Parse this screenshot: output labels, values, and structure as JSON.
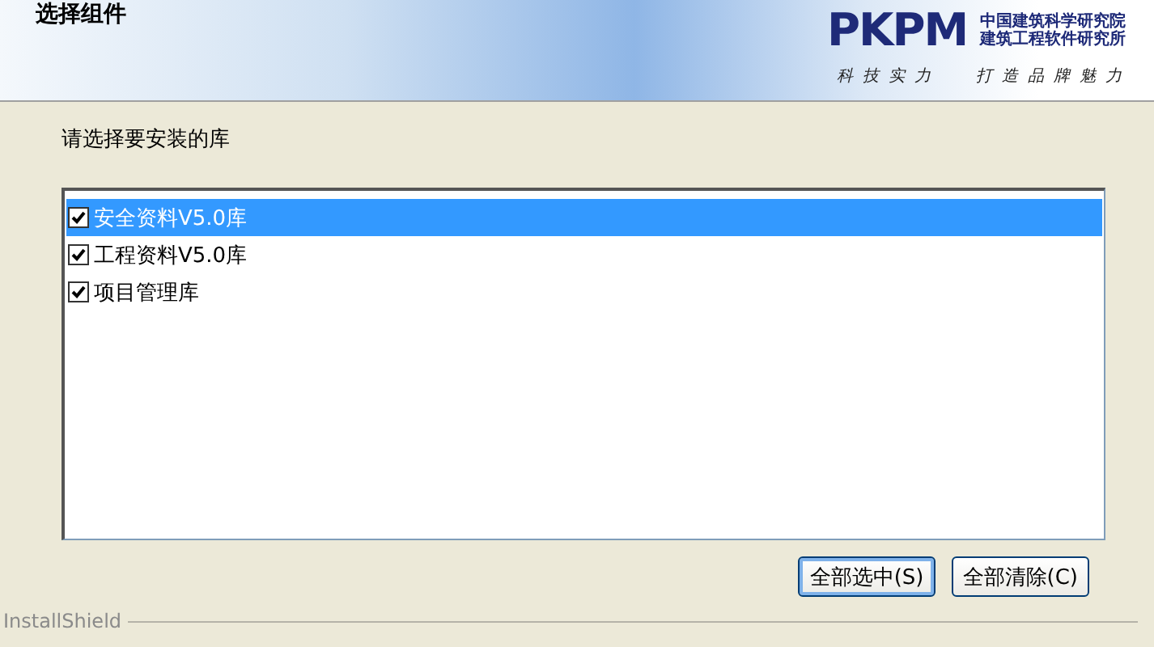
{
  "header": {
    "title": "选择组件",
    "logo": {
      "mark": "PKPM",
      "org_lines": [
        "中国建筑科学研究院",
        "建筑工程软件研究所"
      ],
      "slogan": [
        "科技实力",
        "打造品牌魅力"
      ]
    }
  },
  "prompt": "请选择要安装的库",
  "items": [
    {
      "label": "安全资料V5.0库",
      "checked": true,
      "selected": true
    },
    {
      "label": "工程资料V5.0库",
      "checked": true,
      "selected": false
    },
    {
      "label": "项目管理库",
      "checked": true,
      "selected": false
    }
  ],
  "buttons": [
    {
      "label": "全部选中(S)",
      "focused": true
    },
    {
      "label": "全部清除(C)",
      "focused": false
    }
  ],
  "footer": "InstallShield"
}
